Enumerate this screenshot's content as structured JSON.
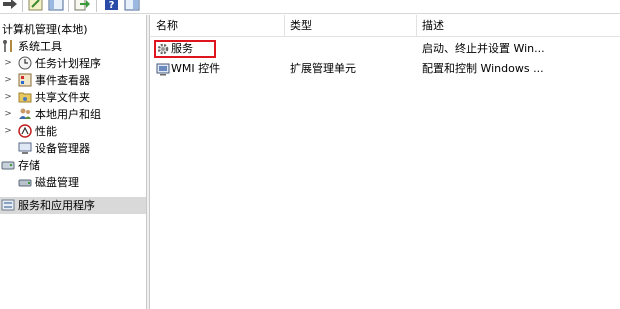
{
  "toolbar": {
    "buttons": [
      {
        "name": "forward-arrow-icon"
      },
      {
        "name": "edit-icon"
      },
      {
        "name": "console-tree-icon"
      },
      {
        "name": "export-icon"
      },
      {
        "name": "help-icon",
        "label": "?"
      },
      {
        "name": "show-pane-icon"
      }
    ]
  },
  "tree": {
    "root_label": "计算机管理(本地)",
    "system_tools": "系统工具",
    "task_scheduler": "任务计划程序",
    "event_viewer": "事件查看器",
    "shared_folders": "共享文件夹",
    "local_users": "本地用户和组",
    "performance": "性能",
    "device_manager": "设备管理器",
    "storage": "存储",
    "disk_management": "磁盘管理",
    "services_apps": "服务和应用程序"
  },
  "list": {
    "columns": {
      "name": "名称",
      "type": "类型",
      "desc": "描述"
    },
    "rows": [
      {
        "name": "服务",
        "type": "",
        "desc": "启动、终止并设置 Win..."
      },
      {
        "name": "WMI 控件",
        "type": "扩展管理单元",
        "desc": "配置和控制 Windows ..."
      }
    ]
  },
  "colors": {
    "highlight": "#e0141e",
    "selected_bg": "#d9d9d9"
  }
}
